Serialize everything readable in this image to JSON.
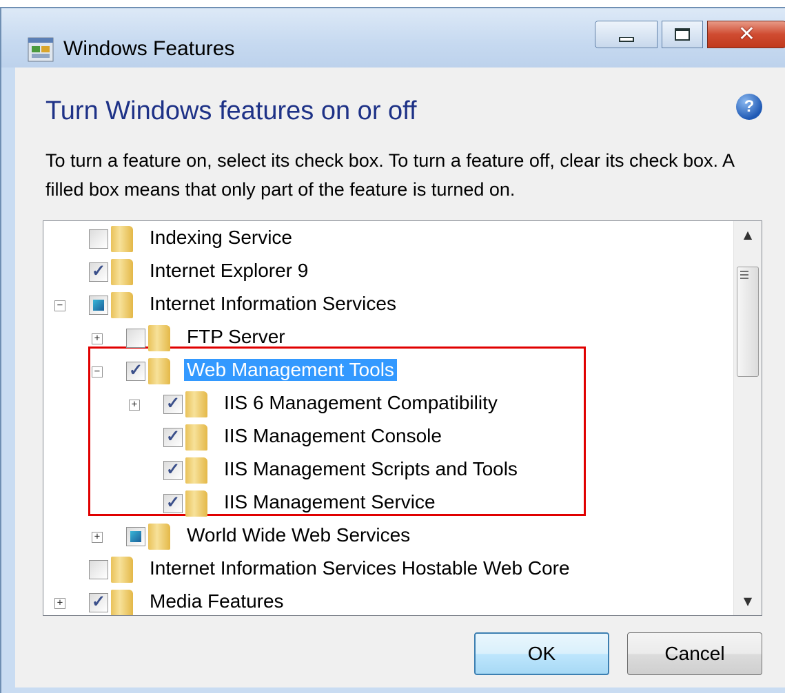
{
  "window": {
    "title": "Windows Features",
    "close_glyph": "✕",
    "heading": "Turn Windows features on or off",
    "help_glyph": "?",
    "description": "To turn a feature on, select its check box. To turn a feature off, clear its check box. A filled box means that only part of the feature is turned on."
  },
  "tree": {
    "items": [
      {
        "label": "Indexing Service",
        "state": "unchecked",
        "level": 0,
        "expander": ""
      },
      {
        "label": "Internet Explorer 9",
        "state": "checked",
        "level": 0,
        "expander": ""
      },
      {
        "label": "Internet Information Services",
        "state": "partial",
        "level": 0,
        "expander": "−"
      },
      {
        "label": "FTP Server",
        "state": "unchecked",
        "level": 1,
        "expander": "+"
      },
      {
        "label": "Web Management Tools",
        "state": "checked",
        "level": 1,
        "expander": "−",
        "selected": true
      },
      {
        "label": "IIS 6 Management Compatibility",
        "state": "checked",
        "level": 2,
        "expander": "+"
      },
      {
        "label": "IIS Management Console",
        "state": "checked",
        "level": 2,
        "expander": ""
      },
      {
        "label": "IIS Management Scripts and Tools",
        "state": "checked",
        "level": 2,
        "expander": ""
      },
      {
        "label": "IIS Management Service",
        "state": "checked",
        "level": 2,
        "expander": ""
      },
      {
        "label": "World Wide Web Services",
        "state": "partial",
        "level": 1,
        "expander": "+"
      },
      {
        "label": "Internet Information Services Hostable Web Core",
        "state": "unchecked",
        "level": 0,
        "expander": ""
      },
      {
        "label": "Media Features",
        "state": "checked",
        "level": 0,
        "expander": "+"
      }
    ]
  },
  "buttons": {
    "ok": "OK",
    "cancel": "Cancel"
  },
  "colors": {
    "heading": "#1e3287",
    "selection": "#3399ff",
    "highlight_box": "#e00000"
  }
}
